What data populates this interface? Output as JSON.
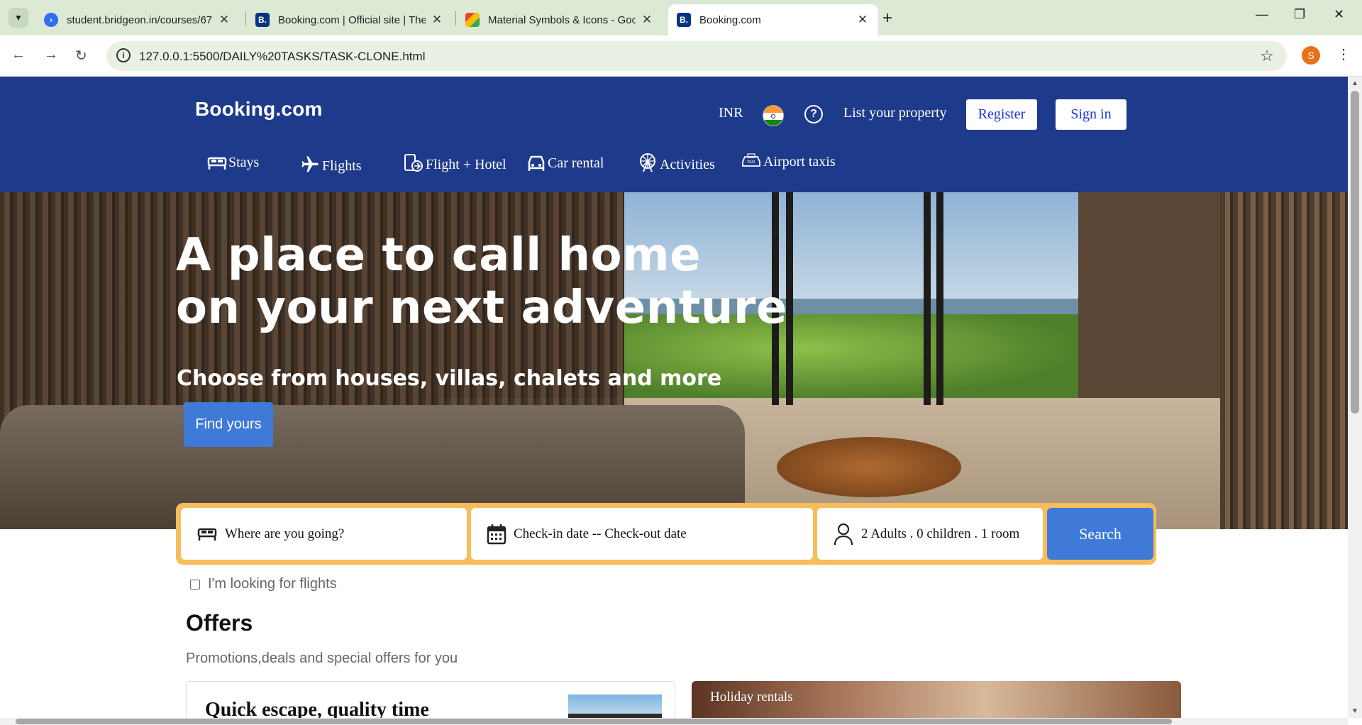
{
  "browser": {
    "tabs": [
      {
        "title": "student.bridgeon.in/courses/67",
        "icon": "bridgeon-icon",
        "fav_color": "#2f6ff0"
      },
      {
        "title": "Booking.com | Official site | The",
        "icon": "booking-icon",
        "fav_color": "#003580"
      },
      {
        "title": "Material Symbols & Icons - Goo",
        "icon": "google-fonts-icon",
        "fav_color": "#e94235"
      },
      {
        "title": "Booking.com",
        "icon": "booking-icon",
        "fav_color": "#003580"
      }
    ],
    "url": "127.0.0.1:5500/DAILY%20TASKS/TASK-CLONE.html",
    "profile_initial": "S"
  },
  "header": {
    "logo": "Booking.com",
    "currency": "INR",
    "list_property": "List your property",
    "register": "Register",
    "sign_in": "Sign in",
    "nav": [
      {
        "label": "Stays",
        "icon": "bed-icon"
      },
      {
        "label": "Flights",
        "icon": "airplane-icon"
      },
      {
        "label": "Flight + Hotel",
        "icon": "flight-hotel-icon"
      },
      {
        "label": "Car rental",
        "icon": "car-icon"
      },
      {
        "label": "Activities",
        "icon": "ferris-wheel-icon"
      },
      {
        "label": "Airport taxis",
        "icon": "taxi-icon"
      }
    ],
    "bg_color": "#1e3a8a"
  },
  "hero": {
    "title_line1": "A place to call home",
    "title_line2": "on your next adventure",
    "subtitle": "Choose from houses, villas, chalets and more",
    "cta": "Find yours"
  },
  "search": {
    "destination": "Where are you going?",
    "dates": "Check-in date -- Check-out date",
    "guests": "2 Adults . 0 children . 1 room",
    "button": "Search",
    "flights_checkbox": "I'm looking for flights",
    "accent_color": "#f6bd5c"
  },
  "offers": {
    "title": "Offers",
    "subtitle": "Promotions,deals and special offers for you",
    "card1_title": "Quick escape, quality time",
    "card2_title": "Holiday rentals"
  }
}
